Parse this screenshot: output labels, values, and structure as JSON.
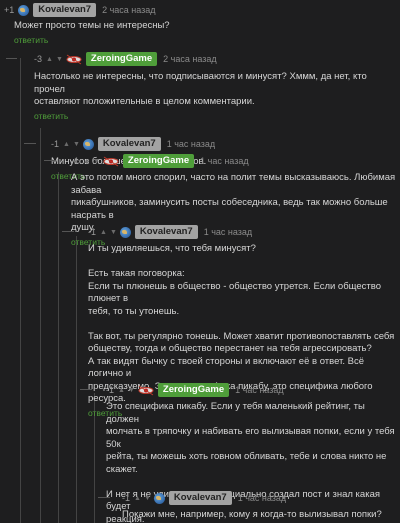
{
  "reply_label": "ответить",
  "comments": [
    {
      "rating": "+1",
      "author": "Kovalevan7",
      "time": "2 часа назад",
      "lines": [
        "Может просто темы не интересны?"
      ]
    },
    {
      "rating": "-3",
      "author": "ZeroingGame",
      "time": "2 часа назад",
      "lines": [
        "Настолько не интересны, что подписываются и минусят? Хммм, да нет, кто прочел",
        "оставляют положительные в целом комментарии."
      ]
    },
    {
      "rating": "-1",
      "author": "Kovalevan7",
      "time": "1 час назад",
      "lines": [
        "Минусов больше чем подписчиков."
      ]
    },
    {
      "rating": "-1",
      "author": "ZeroingGame",
      "time": "1 час назад",
      "lines": [
        "А это потом много спорил, часто на полит темы высказываюсь. Любимая забава",
        "пикабушников, заминусить посты собеседника, ведь так можно больше насрать в",
        "душу."
      ]
    },
    {
      "rating": "-1",
      "author": "Kovalevan7",
      "time": "1 час назад",
      "lines": [
        "И ты удивляешься, что тебя минусят?",
        "",
        "Есть такая поговорка:",
        "Если ты плюнешь в общество - общество утрется. Если общество плюнет в",
        "тебя, то ты утонешь.",
        "",
        "Так вот, ты регулярно тонешь. Может хватит противопоставлять себя",
        "обществу, тогда и общество перестанет на тебя агрессировать?",
        "А так видят бычку с твоей стороны и включают её в ответ. Всё логично и",
        "предсказуемо. Это не специфика пикабу, это специфика любого ресурса."
      ]
    },
    {
      "rating": "-1",
      "author": "ZeroingGame",
      "time": "1 час назад",
      "lines": [
        "Это специфика пикабу. Если у тебя маленький рейтинг, ты должен",
        "молчать в тряпочку и набивать его вылизывая попки, если у тебя 50к",
        "рейта, ты можешь хоть говном обливать, тебе и слова никто не скажет.",
        "",
        "И нет я не удивляюсь, я специально создал пост и знал какая будет",
        "реакция."
      ]
    },
    {
      "rating": "-1",
      "author": "Kovalevan7",
      "time": "1 час назад",
      "lines": [
        "Покажи мне, например, кому я когда-то вылизывал попки?"
      ]
    }
  ]
}
